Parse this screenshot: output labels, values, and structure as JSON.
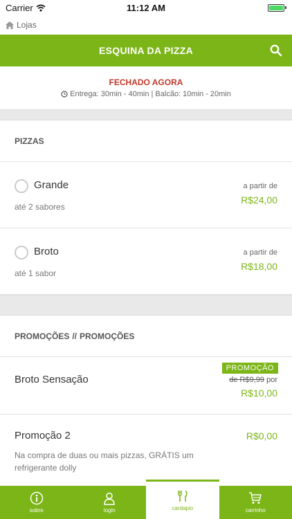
{
  "status_bar": {
    "carrier": "Carrier",
    "time": "11:12 AM",
    "battery_level": 1.0
  },
  "back": {
    "label": "Lojas"
  },
  "header": {
    "title": "ESQUINA DA PIZZA"
  },
  "store_status": {
    "closed": "FECHADO AGORA",
    "times": "Entrega: 30min - 40min | Balcão: 10min - 20min"
  },
  "pizzas": {
    "title": "PIZZAS",
    "items": [
      {
        "name": "Grande",
        "desc": "até 2 sabores",
        "from": "a partir de",
        "price": "R$24,00"
      },
      {
        "name": "Broto",
        "desc": "até 1 sabor",
        "from": "a partir de",
        "price": "R$18,00"
      }
    ]
  },
  "promos": {
    "title_a": "PROMOÇÕES",
    "separator": "//",
    "title_b": "PROMOÇÕES",
    "items": [
      {
        "name": "Broto Sensação",
        "badge": "PROMOÇÃO",
        "old_price": "de R$9,99",
        "por": "por",
        "price": "R$10,00"
      },
      {
        "name": "Promoção 2",
        "price": "R$0,00",
        "desc": "Na compra de duas ou mais pizzas, GRÁTIS um refrigerante dolly"
      }
    ]
  },
  "tabs": [
    {
      "label": "sobre",
      "icon": "info-icon"
    },
    {
      "label": "login",
      "icon": "user-icon"
    },
    {
      "label": "cardapio",
      "icon": "cutlery-icon",
      "active": true
    },
    {
      "label": "carrinho",
      "icon": "cart-icon"
    }
  ],
  "colors": {
    "accent": "#7cb518",
    "closed": "#c0392b"
  }
}
